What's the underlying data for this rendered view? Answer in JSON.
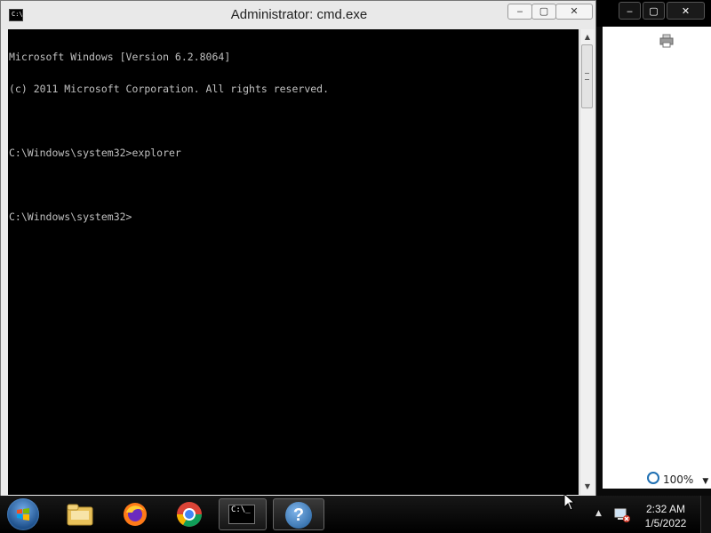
{
  "window": {
    "title": "Administrator: cmd.exe",
    "icon": "cmd-icon",
    "buttons": {
      "minimize": "‒",
      "maximize": "▢",
      "close": "✕"
    }
  },
  "console": {
    "lines": [
      "Microsoft Windows [Version 6.2.8064]",
      "(c) 2011 Microsoft Corporation. All rights reserved.",
      "",
      "C:\\Windows\\system32>explorer",
      "",
      "C:\\Windows\\system32>"
    ]
  },
  "background_window": {
    "buttons": {
      "minimize": "‒",
      "maximize": "▢",
      "close": "✕"
    },
    "printer_icon": "printer-icon",
    "zoom": "100%"
  },
  "taskbar": {
    "start": "start-orb-icon",
    "items": [
      {
        "name": "folder-icon"
      },
      {
        "name": "firefox-icon"
      },
      {
        "name": "chrome-icon"
      },
      {
        "name": "cmd-icon",
        "label": "C:\\_"
      },
      {
        "name": "help-icon",
        "label": "?"
      }
    ],
    "tray": {
      "arrow": "▲",
      "network_icon": "network-warning-icon"
    },
    "clock": {
      "time": "2:32 AM",
      "date": "1/5/2022"
    }
  },
  "colors": {
    "console_bg": "#000000",
    "console_fg": "#c0c0c0",
    "taskbar": "#111111",
    "accent_blue": "#1d4f8a"
  }
}
